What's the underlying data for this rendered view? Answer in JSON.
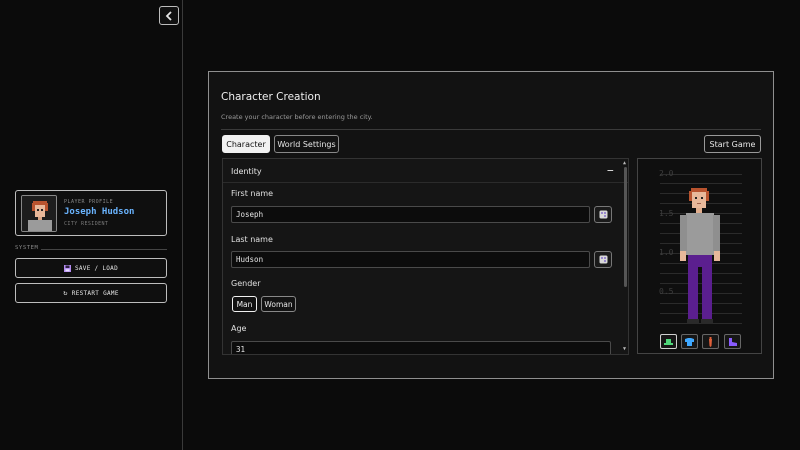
{
  "sidebar": {
    "profile": {
      "eyebrow": "PLAYER PROFILE",
      "name": "Joseph Hudson",
      "role": "CITY RESIDENT"
    },
    "system_label": "SYSTEM",
    "save_label": "SAVE / LOAD",
    "restart_label": "RESTART GAME",
    "restart_glyph": "↻"
  },
  "panel": {
    "title": "Character Creation",
    "subtitle": "Create your character before entering the city.",
    "tabs": [
      {
        "label": "Character",
        "active": true
      },
      {
        "label": "World Settings",
        "active": false
      }
    ],
    "start_label": "Start Game",
    "section": {
      "title": "Identity",
      "collapse_glyph": "−"
    },
    "fields": {
      "first_name": {
        "label": "First name",
        "value": "Joseph"
      },
      "last_name": {
        "label": "Last name",
        "value": "Hudson"
      },
      "gender": {
        "label": "Gender",
        "options": [
          "Man",
          "Woman"
        ],
        "selected": "Man"
      },
      "age": {
        "label": "Age",
        "value": "31"
      }
    }
  },
  "preview": {
    "height_ticks": [
      "2.0",
      "1.5",
      "1.0",
      "0.5"
    ],
    "outfit_slots": [
      "hat-icon",
      "shirt-icon",
      "tie-icon",
      "shoe-icon"
    ]
  },
  "colors": {
    "accent_name": "#6ab4ff",
    "background": "#0b0b0b",
    "panel": "#121212",
    "hair": "#b8532e",
    "shirt": "#9b9b9b",
    "pants": "#5b1f8f"
  }
}
